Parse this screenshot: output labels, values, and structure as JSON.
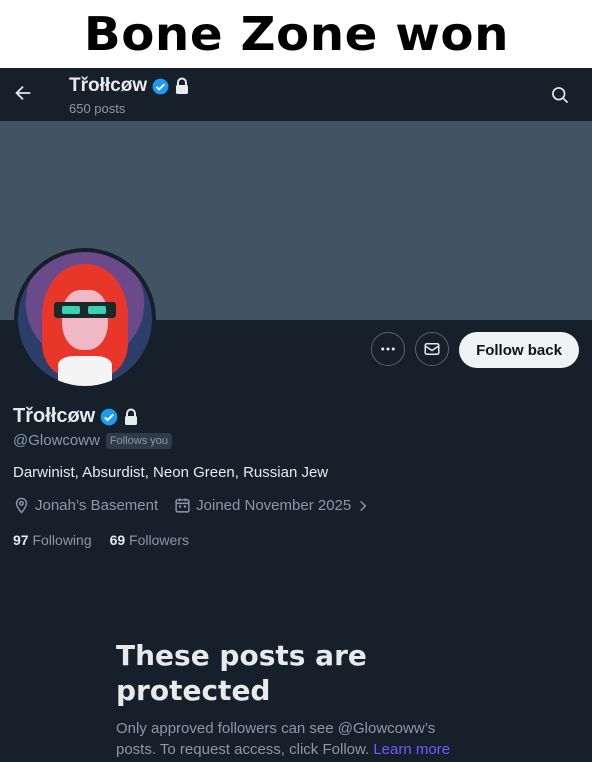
{
  "caption": {
    "text": "Bone Zone won"
  },
  "header": {
    "name": "Třołłcøw",
    "post_count": "650 posts"
  },
  "profile": {
    "name": "Třołłcøw",
    "handle": "@Glowcoww",
    "follows_you": "Follows you",
    "bio": "Darwinist, Absurdist, Neon Green, Russian Jew",
    "location": "Jonah’s Basement",
    "joined": "Joined November 2025",
    "following_count": "97",
    "following_label": "Following",
    "followers_count": "69",
    "followers_label": "Followers"
  },
  "actions": {
    "follow_back": "Follow back"
  },
  "protected": {
    "title": "These posts are protected",
    "desc": "Only approved followers can see @Glowcoww’s posts. To request access, click Follow.",
    "learn_more": "Learn more"
  },
  "colors": {
    "background": "#15202b",
    "banner": "#425364",
    "verified": "#1d9bf0",
    "link": "#7856ff"
  },
  "icons": [
    "back-arrow-icon",
    "verified-badge-icon",
    "lock-icon",
    "search-icon",
    "more-icon",
    "mail-icon",
    "location-icon",
    "calendar-icon",
    "chevron-right-icon"
  ]
}
